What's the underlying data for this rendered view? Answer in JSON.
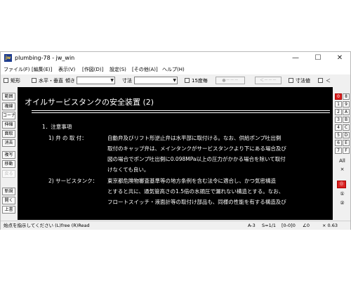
{
  "window": {
    "title": "plumbing-78 - jw_win",
    "icon_label": "jw",
    "minimize": "—",
    "maximize": "☐",
    "close": "✕"
  },
  "menu": [
    "ファイル(F)",
    "[編集(E)]",
    "表示(V)",
    "[作図(D)]",
    "設定(S)",
    "[その他(A)]",
    "ヘルプ(H)"
  ],
  "toolbar": {
    "rect_label": "矩形",
    "horiz_vert_label": "水平・垂直",
    "slope_label": "傾き",
    "dim_label": "寸法",
    "angle15_label": "15度毎",
    "btn1_label": "●－－－",
    "btn2_label": "＜－－－",
    "dimvalue_label": "寸法値",
    "lt_label": "＜"
  },
  "left_tools": [
    "範囲",
    "複線",
    "コーナー",
    "伸縮",
    "面取",
    "消去",
    "複写",
    "移動",
    "戻る",
    "新規",
    "開く",
    "上書"
  ],
  "document": {
    "title": "オイルサービスタンクの安全装置 (2)",
    "heading": "1．注意事項",
    "item1_label": "1) 弁 の 取 付：",
    "item1_lines": [
      "自動弁及びリフト形逆止弁は水平部に取付ける。なお、供給ポンプ吐出側",
      "取付のキャップ弁は、メインタンクがサービスタンクより下にある場合及び",
      "図の場合でポンプ吐出側に0.098MPa以上の圧力がかかる場合を除いて取付",
      "けなくても良い。"
    ],
    "item2_label": "2) サービスタンク：",
    "item2_lines": [
      "東京都危険物審査基準等の地方条例を含む法令に適合し、かつ気密構造",
      "とすると共に、通気管高さの1.5倍の水頭圧で漏れない構造とする。なお、",
      "フロートスイッチ・液面計等の取付け部品も、同様の性能を有する構造及び"
    ]
  },
  "right_tools": {
    "pairs": [
      [
        "0",
        "8"
      ],
      [
        "1",
        "9"
      ],
      [
        "2",
        "A"
      ],
      [
        "3",
        "B"
      ],
      [
        "4",
        "C"
      ],
      [
        "5",
        "D"
      ],
      [
        "6",
        "E"
      ],
      [
        "7",
        "F"
      ]
    ],
    "all_label": "All",
    "extra": [
      "×",
      "⓪",
      "①",
      "②"
    ]
  },
  "status": {
    "hint": "始点を指示してください (L)free (R)Read",
    "paper": "A-3",
    "scale": "S=1/1",
    "layer": "[0-0]0",
    "angle": "∠0",
    "zoom": "× 0.63"
  },
  "colors": {
    "canvas_bg": "#000000",
    "canvas_text": "#ffffff",
    "active_layer": "#d92020"
  }
}
